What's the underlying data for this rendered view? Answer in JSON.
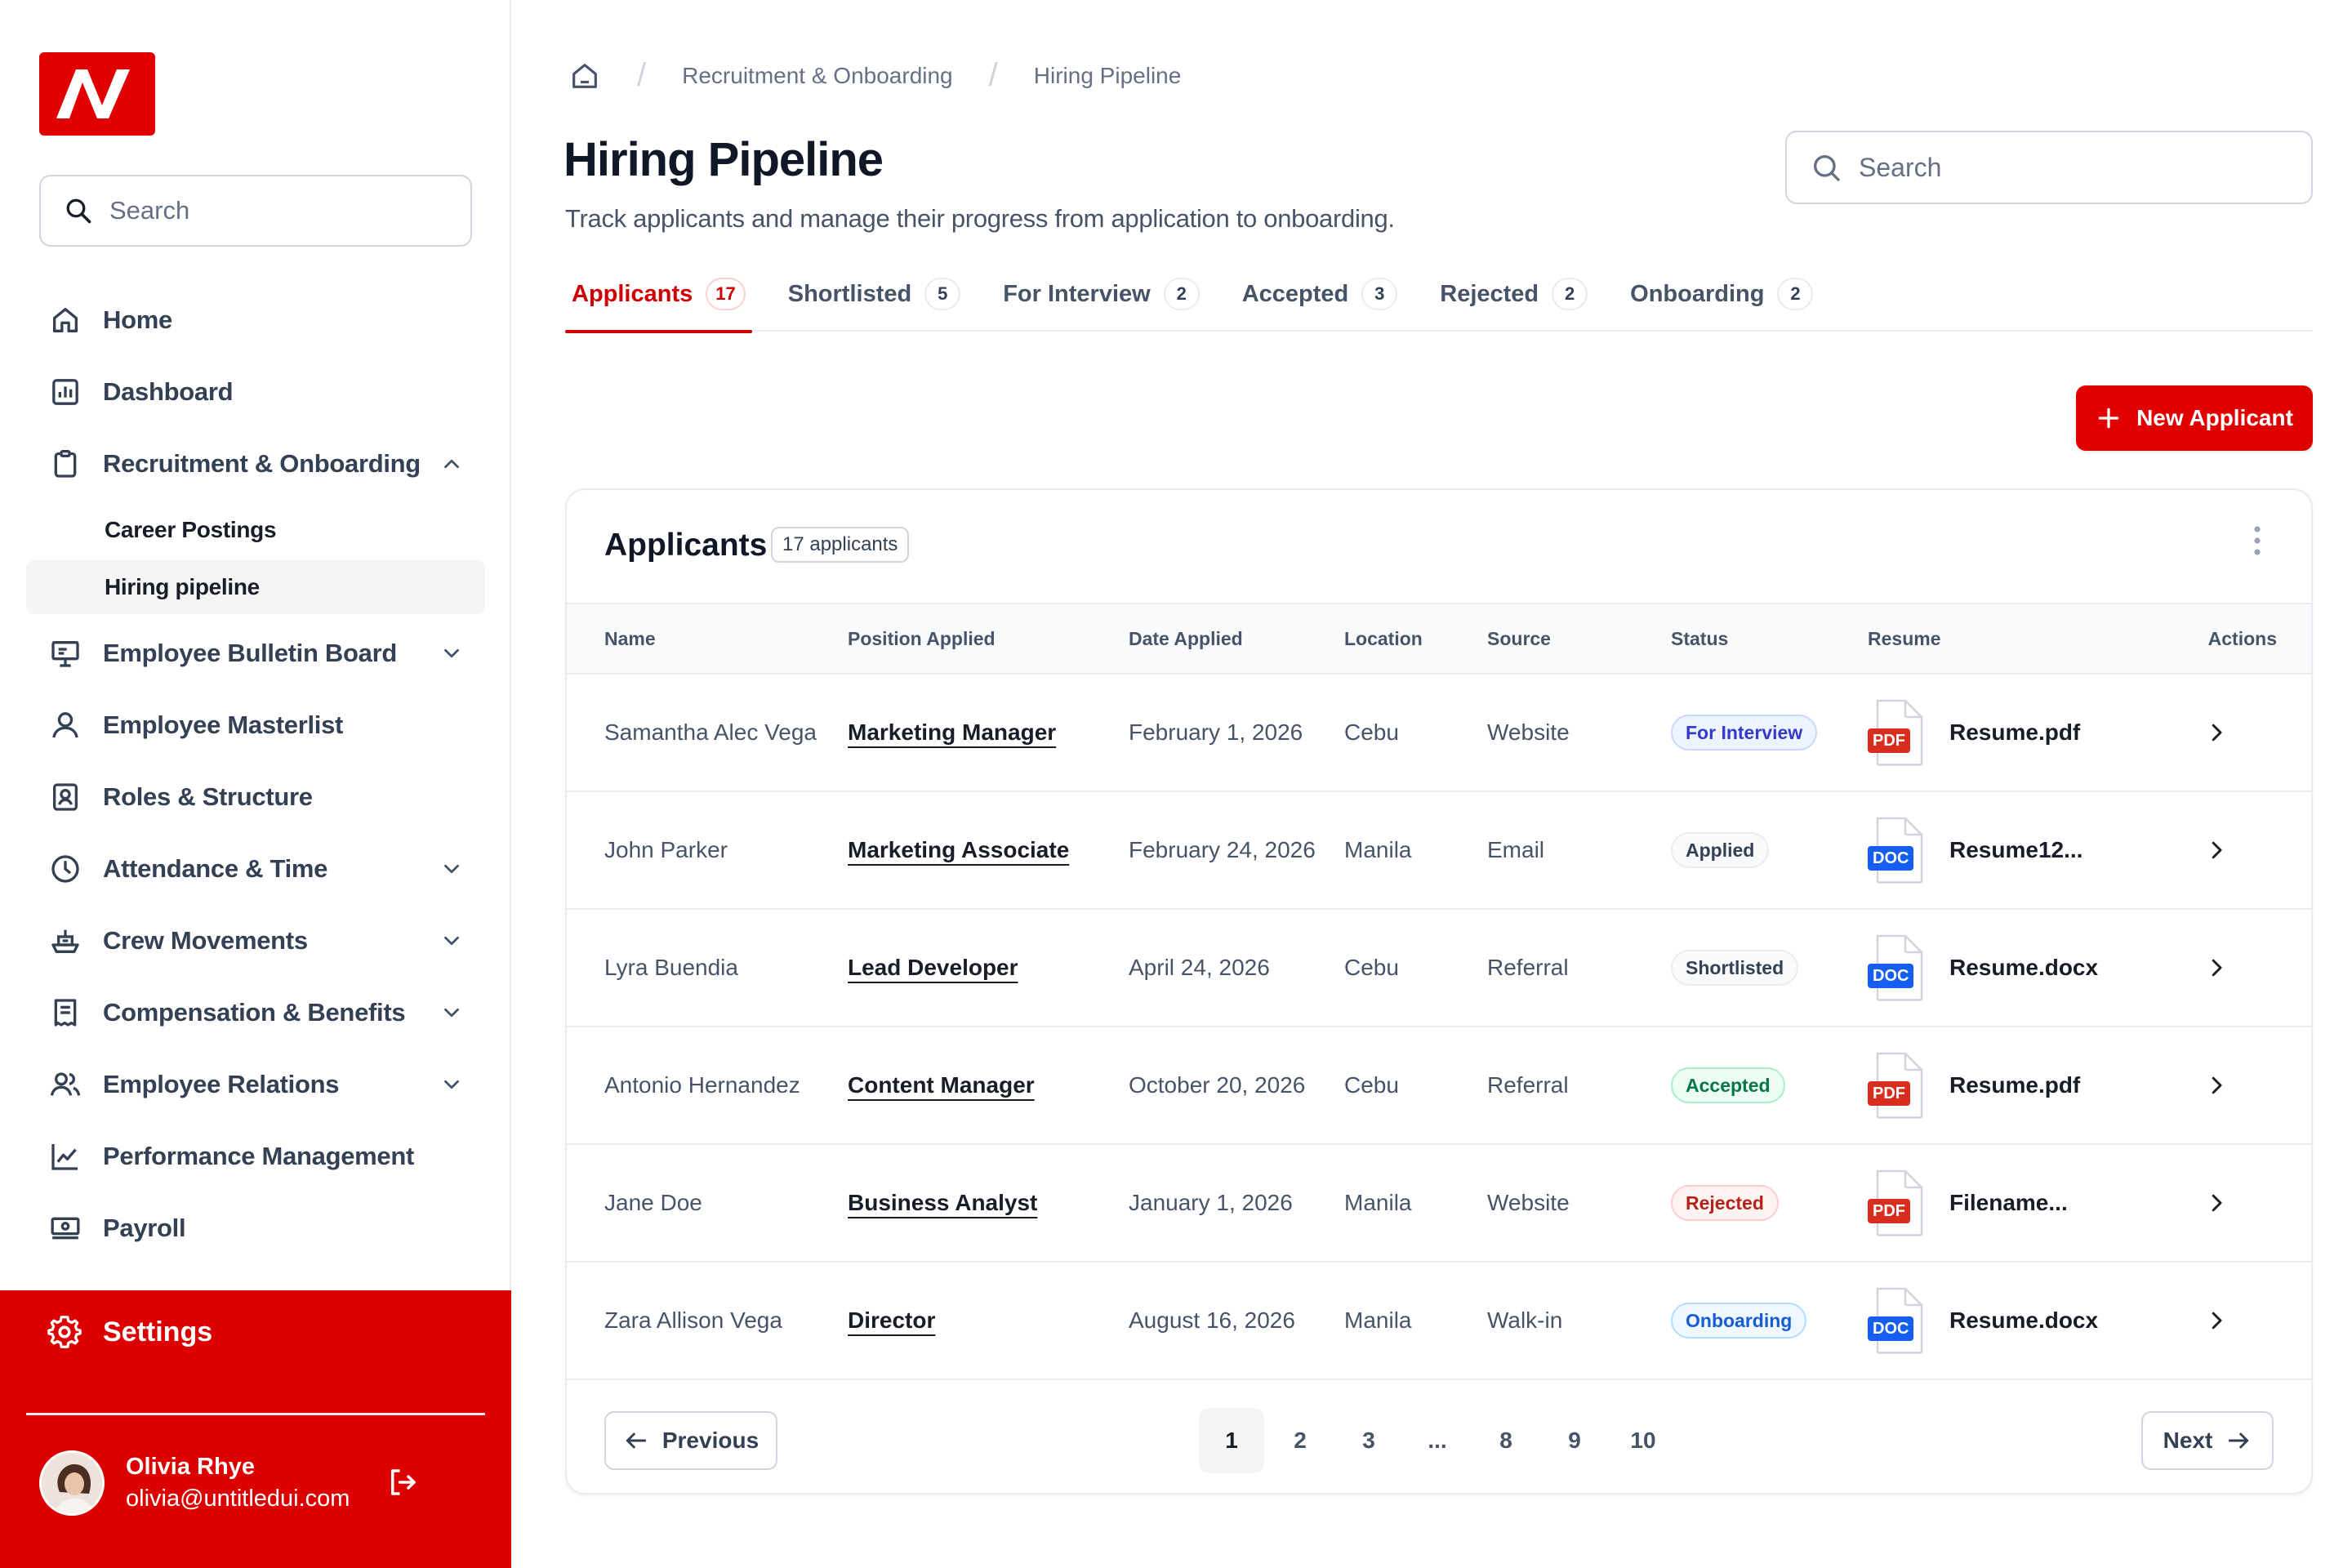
{
  "sidebar": {
    "logo_text": "AV",
    "search_placeholder": "Search",
    "nav": [
      {
        "label": "Home",
        "icon": "home-icon"
      },
      {
        "label": "Dashboard",
        "icon": "bar-chart-icon"
      },
      {
        "label": "Recruitment & Onboarding",
        "icon": "clipboard-icon",
        "expanded": true
      },
      {
        "label": "Employee Bulletin Board",
        "icon": "presentation-icon",
        "expanded": false
      },
      {
        "label": "Employee Masterlist",
        "icon": "user-icon"
      },
      {
        "label": "Roles & Structure",
        "icon": "id-badge-icon"
      },
      {
        "label": "Attendance & Time",
        "icon": "clock-icon",
        "expanded": false
      },
      {
        "label": "Crew Movements",
        "icon": "ship-icon",
        "expanded": false
      },
      {
        "label": "Compensation & Benefits",
        "icon": "receipt-icon",
        "expanded": false
      },
      {
        "label": "Employee Relations",
        "icon": "users-icon",
        "expanded": false
      },
      {
        "label": "Performance Management",
        "icon": "line-chart-icon"
      },
      {
        "label": "Payroll",
        "icon": "money-icon"
      }
    ],
    "sub_items": [
      {
        "label": "Career Postings"
      },
      {
        "label": "Hiring pipeline",
        "active": true
      }
    ],
    "settings_label": "Settings",
    "user": {
      "name": "Olivia Rhye",
      "email": "olivia@untitledui.com"
    }
  },
  "breadcrumb": {
    "items": [
      "Recruitment & Onboarding",
      "Hiring Pipeline"
    ]
  },
  "header": {
    "title": "Hiring Pipeline",
    "subtitle": "Track applicants and manage their progress from application to onboarding.",
    "search_placeholder": "Search"
  },
  "tabs": [
    {
      "label": "Applicants",
      "count": "17",
      "active": true
    },
    {
      "label": "Shortlisted",
      "count": "5"
    },
    {
      "label": "For Interview",
      "count": "2"
    },
    {
      "label": "Accepted",
      "count": "3"
    },
    {
      "label": "Rejected",
      "count": "2"
    },
    {
      "label": "Onboarding",
      "count": "2"
    }
  ],
  "new_button_label": "New Applicant",
  "card": {
    "title": "Applicants",
    "badge": "17 applicants"
  },
  "table": {
    "columns": [
      "Name",
      "Position Applied",
      "Date Applied",
      "Location",
      "Source",
      "Status",
      "Resume",
      "Actions"
    ],
    "rows": [
      {
        "name": "Samantha Alec Vega",
        "position": "Marketing Manager",
        "date": "February 1, 2026",
        "location": "Cebu",
        "source": "Website",
        "status": "For Interview",
        "status_class": "st-interview",
        "file_type": "PDF",
        "file_name": "Resume.pdf"
      },
      {
        "name": "John Parker",
        "position": "Marketing Associate",
        "date": "February 24, 2026",
        "location": "Manila",
        "source": "Email",
        "status": "Applied",
        "status_class": "st-applied",
        "file_type": "DOC",
        "file_name": "Resume12..."
      },
      {
        "name": "Lyra Buendia",
        "position": "Lead Developer",
        "date": "April 24, 2026",
        "location": "Cebu",
        "source": "Referral",
        "status": "Shortlisted",
        "status_class": "st-shortlisted",
        "file_type": "DOC",
        "file_name": "Resume.docx"
      },
      {
        "name": "Antonio Hernandez",
        "position": "Content Manager",
        "date": "October 20, 2026",
        "location": "Cebu",
        "source": "Referral",
        "status": "Accepted",
        "status_class": "st-accepted",
        "file_type": "PDF",
        "file_name": "Resume.pdf"
      },
      {
        "name": "Jane Doe",
        "position": "Business Analyst",
        "date": "January 1, 2026",
        "location": "Manila",
        "source": "Website",
        "status": "Rejected",
        "status_class": "st-rejected",
        "file_type": "PDF",
        "file_name": "Filename..."
      },
      {
        "name": "Zara Allison Vega",
        "position": "Director",
        "date": "August 16, 2026",
        "location": "Manila",
        "source": "Walk-in",
        "status": "Onboarding",
        "status_class": "st-onboarding",
        "file_type": "DOC",
        "file_name": "Resume.docx"
      }
    ]
  },
  "pagination": {
    "previous_label": "Previous",
    "next_label": "Next",
    "pages": [
      "1",
      "2",
      "3",
      "...",
      "8",
      "9",
      "10"
    ],
    "current": "1"
  },
  "colors": {
    "brand": "#dc0000",
    "text": "#181d27",
    "muted": "#475467"
  }
}
